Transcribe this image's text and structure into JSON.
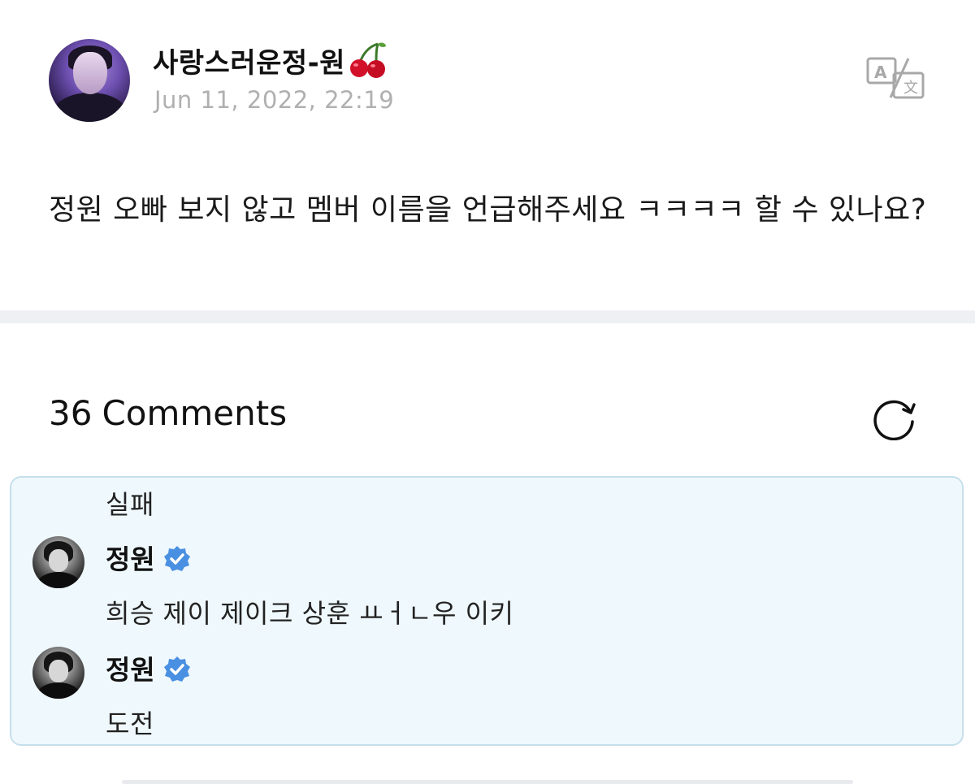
{
  "post": {
    "author_name": "사랑스러운정-원",
    "author_emoji": "cherry-icon",
    "date": "Jun 11, 2022, 22:19",
    "body": "정원 오빠 보지 않고 멤버 이름을 언급해주세요 ㅋㅋㅋㅋ  할 수 있나요?"
  },
  "comments": {
    "count": "36",
    "label": "Comments",
    "thread": [
      {
        "text": "실패"
      },
      {
        "author": "정원",
        "verified": true,
        "text": "희승 제이 제이크 상훈 ㅛㅓㄴ우 이키"
      },
      {
        "author": "정원",
        "verified": true,
        "text": "도전"
      }
    ]
  },
  "colors": {
    "verified_badge": "#4a90e2",
    "thread_background": "#eff8fc",
    "thread_border": "#c6dfec",
    "date_text": "#b0b0b0",
    "divider": "#eef0f3"
  },
  "icons": {
    "translate": "translate-icon",
    "refresh": "refresh-icon",
    "verified": "verified-icon"
  }
}
